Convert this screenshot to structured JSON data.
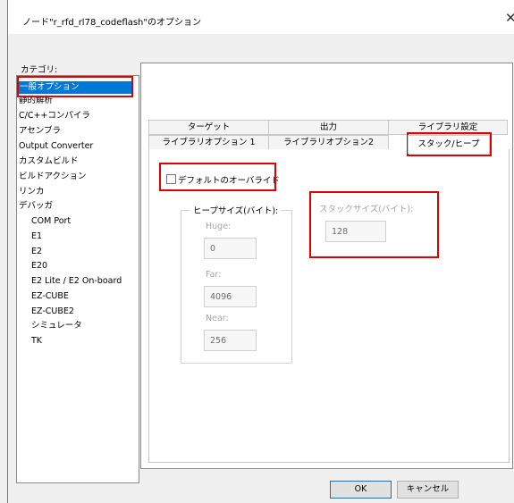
{
  "window": {
    "title": "ノード\"r_rfd_rl78_codeflash\"のオプション",
    "close_glyph": "✕"
  },
  "categories": {
    "label": "カテゴリ:",
    "items": [
      {
        "label": "一般オプション"
      },
      {
        "label": "静的解析"
      },
      {
        "label": "C/C++コンパイラ"
      },
      {
        "label": "アセンブラ"
      },
      {
        "label": "Output Converter"
      },
      {
        "label": "カスタムビルド"
      },
      {
        "label": "ビルドアクション"
      },
      {
        "label": "リンカ"
      },
      {
        "label": "デバッガ"
      },
      {
        "label": "COM Port"
      },
      {
        "label": "E1"
      },
      {
        "label": "E2"
      },
      {
        "label": "E20"
      },
      {
        "label": "E2 Lite / E2 On-board"
      },
      {
        "label": "EZ-CUBE"
      },
      {
        "label": "EZ-CUBE2"
      },
      {
        "label": "シミュレータ"
      },
      {
        "label": "TK"
      }
    ],
    "selected": "一般オプション"
  },
  "tabs": {
    "row1": [
      "ターゲット",
      "出力",
      "ライブラリ設定"
    ],
    "row2": [
      "ライブラリオプション 1",
      "ライブラリオプション2",
      "スタック/ヒープ"
    ],
    "active": "スタック/ヒープ"
  },
  "stackheap": {
    "override_label": "デフォルトのオーバライド",
    "override_checked": false,
    "heap": {
      "title": "ヒープサイズ(バイト):",
      "huge_label": "Huge:",
      "huge_value": "0",
      "far_label": "Far:",
      "far_value": "4096",
      "near_label": "Near:",
      "near_value": "256"
    },
    "stack": {
      "label": "スタックサイズ(バイト):",
      "value": "128"
    }
  },
  "buttons": {
    "ok": "OK",
    "cancel": "キャンセル"
  },
  "colors": {
    "selection": "#0078d7",
    "highlight_box": "#e10000"
  }
}
